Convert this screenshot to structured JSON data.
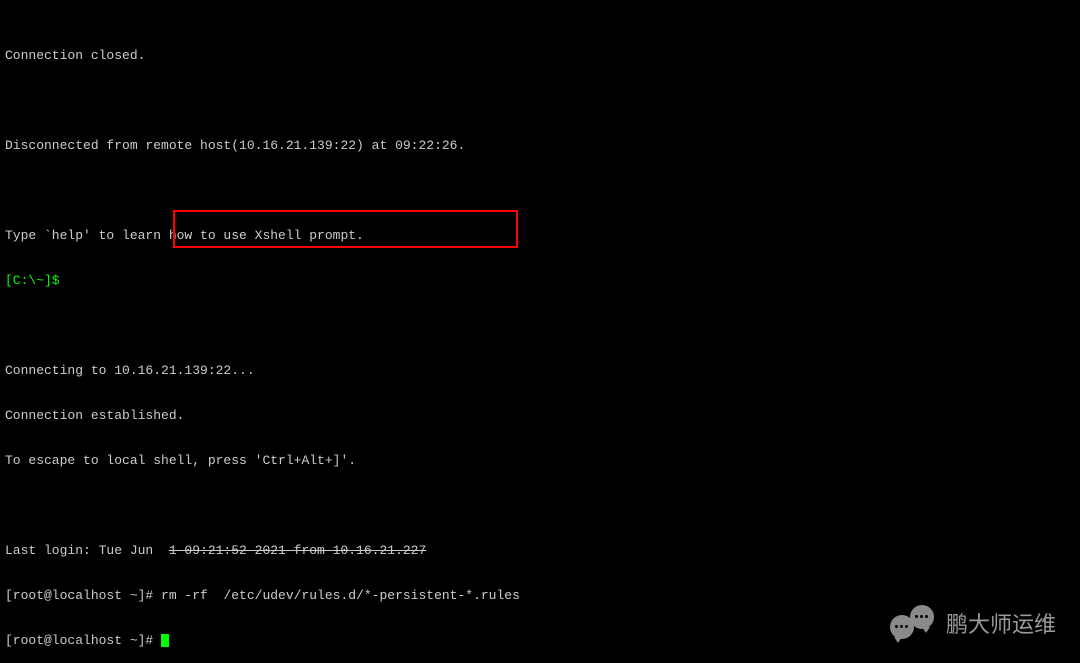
{
  "lines": {
    "closed": "Connection closed.",
    "disconnected": "Disconnected from remote host(10.16.21.139:22) at 09:22:26.",
    "help": "Type `help' to learn how to use Xshell prompt.",
    "local_prompt": "[C:\\~]$ ",
    "connecting": "Connecting to 10.16.21.139:22...",
    "established": "Connection established.",
    "escape": "To escape to local shell, press 'Ctrl+Alt+]'.",
    "last_login_prefix": "Last login: Tue Jun  ",
    "last_login_struck": "1 09:21:52 2021 from 10.16.21.227",
    "prompt1": "[root@localhost ~]# ",
    "command1": "rm -rf  /etc/udev/rules.d/*-persistent-*.rules",
    "prompt2": "[root@localhost ~]# "
  },
  "watermark": {
    "text": "鹏大师运维"
  }
}
